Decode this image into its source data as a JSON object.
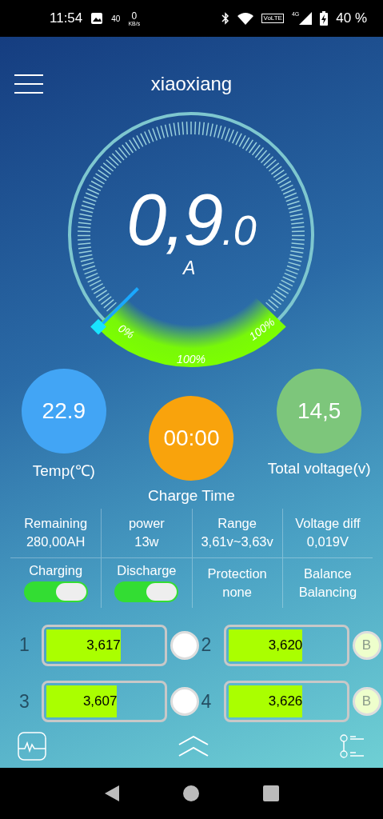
{
  "status_bar": {
    "time": "11:54",
    "indicator": "40",
    "speed": "0",
    "speed_unit": "KB/s",
    "volte": "VoLTE",
    "network": "4G",
    "battery": "40 %"
  },
  "header": {
    "title": "xiaoxiang"
  },
  "gauge": {
    "value": "0,9",
    "decimal": ".0",
    "unit": "A",
    "scale_labels": [
      "0%",
      "100%",
      "100%"
    ]
  },
  "readouts": [
    {
      "value": "22.9",
      "label": "Temp(℃)",
      "color": "#42a5f5"
    },
    {
      "value": "00:00",
      "label": "Charge Time",
      "color": "#f9a30c"
    },
    {
      "value": "14,5",
      "label": "Total voltage(v)",
      "color": "#7dc67b"
    }
  ],
  "stats": [
    {
      "label": "Remaining",
      "value": "280,00AH"
    },
    {
      "label": "power",
      "value": "13w"
    },
    {
      "label": "Range",
      "value": "3,61v~3,63v"
    },
    {
      "label": "Voltage diff",
      "value": "0,019V"
    }
  ],
  "controls": [
    {
      "kind": "switch",
      "label": "Charging",
      "on": true
    },
    {
      "kind": "switch",
      "label": "Discharge",
      "on": true
    },
    {
      "kind": "text",
      "label": "Protection",
      "value": "none"
    },
    {
      "kind": "text",
      "label": "Balance",
      "value": "Balancing"
    }
  ],
  "cells": [
    {
      "number": "1",
      "voltage": "3,617",
      "level": 0.64,
      "balancing": false
    },
    {
      "number": "2",
      "voltage": "3,620",
      "level": 0.64,
      "balancing": true,
      "badge": "B"
    },
    {
      "number": "3",
      "voltage": "3,607",
      "level": 0.61,
      "balancing": false
    },
    {
      "number": "4",
      "voltage": "3,626",
      "level": 0.64,
      "balancing": true,
      "badge": "B"
    }
  ]
}
